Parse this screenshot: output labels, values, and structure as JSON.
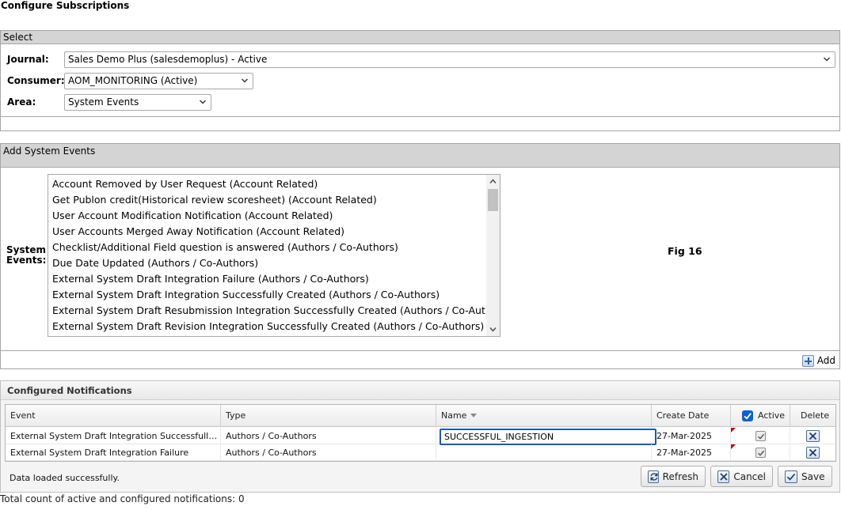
{
  "page": {
    "title": "Configure Subscriptions"
  },
  "select": {
    "header": "Select",
    "journal": {
      "label": "Journal:",
      "value": "Sales Demo Plus (salesdemoplus) - Active"
    },
    "consumer": {
      "label": "Consumer:",
      "value": "AOM_MONITORING (Active)"
    },
    "area": {
      "label": "Area:",
      "value": "System Events"
    }
  },
  "add_events": {
    "header": "Add System Events",
    "label_line1": "System",
    "label_line2": "Events:",
    "items": [
      "Account Removed by User Request (Account Related)",
      "Get Publon credit(Historical review scoresheet) (Account Related)",
      "User Account Modification Notification (Account Related)",
      "User Accounts Merged Away Notification (Account Related)",
      "Checklist/Additional Field question is answered (Authors / Co-Authors)",
      "Due Date Updated (Authors / Co-Authors)",
      "External System Draft Integration Failure (Authors / Co-Authors)",
      "External System Draft Integration Successfully Created (Authors / Co-Authors)",
      "External System Draft Resubmission Integration Successfully Created (Authors / Co-Authors)",
      "External System Draft Revision Integration Successfully Created (Authors / Co-Authors)"
    ],
    "fig_label": "Fig 16",
    "add_label": "Add"
  },
  "configured": {
    "header": "Configured Notifications",
    "columns": {
      "event": "Event",
      "type": "Type",
      "name": "Name",
      "create_date": "Create Date",
      "active": "Active",
      "delete": "Delete"
    },
    "rows": [
      {
        "event": "External System Draft Integration Successfully Created (Authors / Co-Authors)",
        "type": "Authors / Co-Authors",
        "name": "SUCCESSFUL_INGESTION",
        "create_date": "27-Mar-2025",
        "active": true
      },
      {
        "event": "External System Draft Integration Failure",
        "type": "Authors / Co-Authors",
        "name": "",
        "create_date": "27-Mar-2025",
        "active": true
      }
    ],
    "status": "Data loaded successfully.",
    "buttons": {
      "refresh": "Refresh",
      "cancel": "Cancel",
      "save": "Save"
    }
  },
  "total": "Total count of active and configured notifications: 0",
  "colors": {
    "header_bg": "#d4d4d4",
    "focus_border": "#1c5bb0",
    "checkbox_blue": "#0e5fd8",
    "dirty_marker": "#cc0000"
  }
}
